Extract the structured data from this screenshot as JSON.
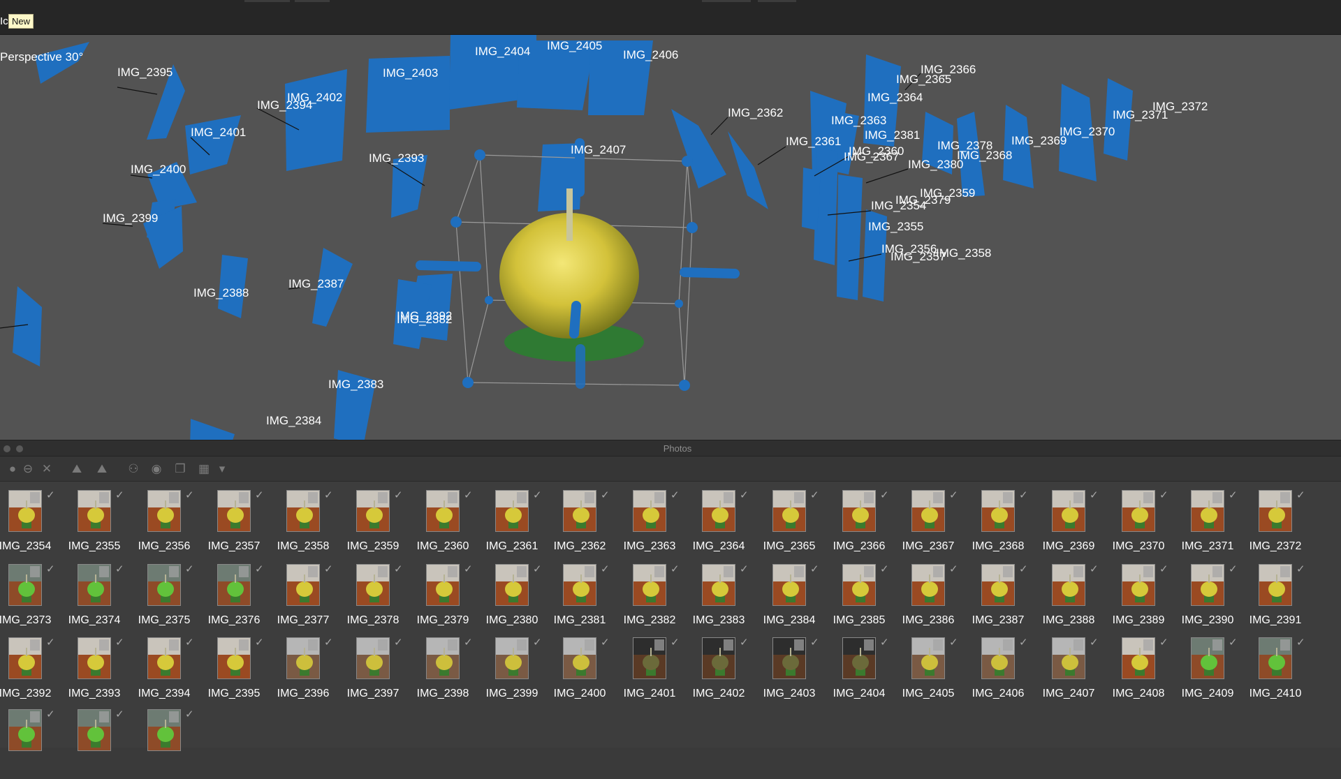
{
  "window": {
    "tooltip": "New",
    "tooltip_prefix": "Ic"
  },
  "viewport": {
    "view_label": "Perspective 30°",
    "camera_labels": [
      "IMG_2395",
      "IMG_2394",
      "IMG_2402",
      "IMG_2403",
      "IMG_2404",
      "IMG_2405",
      "IMG_2406",
      "IMG_2401",
      "IMG_2400",
      "IMG_2399",
      "IMG_2393",
      "IMG_2407",
      "IMG_2388",
      "IMG_2387",
      "IMG_2392",
      "IMG_2382",
      "IMG_2383",
      "IMG_2384",
      "IMG_2362",
      "IMG_2366",
      "IMG_2365",
      "IMG_2364",
      "IMG_2363",
      "IMG_2381",
      "IMG_2361",
      "IMG_2360",
      "IMG_2367",
      "IMG_2380",
      "IMG_2378",
      "IMG_2368",
      "IMG_2369",
      "IMG_2370",
      "IMG_2371",
      "IMG_2372",
      "IMG_2359",
      "IMG_2379",
      "IMG_2354",
      "IMG_2355",
      "IMG_2356",
      "IMG_2357",
      "IMG_2358"
    ]
  },
  "photos_panel": {
    "title": "Photos",
    "toolbar": [
      {
        "name": "add-icon",
        "glyph": "●"
      },
      {
        "name": "remove-icon",
        "glyph": "⊖"
      },
      {
        "name": "delete-icon",
        "glyph": "✕"
      },
      {
        "name": "enable-icon",
        "glyph": "⛰"
      },
      {
        "name": "disable-icon",
        "glyph": "⛰"
      },
      {
        "name": "binoculars-icon",
        "glyph": "⚇"
      },
      {
        "name": "mask-icon",
        "glyph": "◉"
      },
      {
        "name": "stack-icon",
        "glyph": "❐"
      },
      {
        "name": "view-mode-icon",
        "glyph": "▦"
      },
      {
        "name": "dropdown-icon",
        "glyph": "▾"
      }
    ],
    "photos": [
      "IMG_2354",
      "IMG_2355",
      "IMG_2356",
      "IMG_2357",
      "IMG_2358",
      "IMG_2359",
      "IMG_2360",
      "IMG_2361",
      "IMG_2362",
      "IMG_2363",
      "IMG_2364",
      "IMG_2365",
      "IMG_2366",
      "IMG_2367",
      "IMG_2368",
      "IMG_2369",
      "IMG_2370",
      "IMG_2371",
      "IMG_2372",
      "IMG_2373",
      "IMG_2374",
      "IMG_2375",
      "IMG_2376",
      "IMG_2377",
      "IMG_2378",
      "IMG_2379",
      "IMG_2380",
      "IMG_2381",
      "IMG_2382",
      "IMG_2383",
      "IMG_2384",
      "IMG_2385",
      "IMG_2386",
      "IMG_2387",
      "IMG_2388",
      "IMG_2389",
      "IMG_2390",
      "IMG_2391",
      "IMG_2392",
      "IMG_2393",
      "IMG_2394",
      "IMG_2395",
      "IMG_2396",
      "IMG_2397",
      "IMG_2398",
      "IMG_2399",
      "IMG_2400",
      "IMG_2401",
      "IMG_2402",
      "IMG_2403",
      "IMG_2404",
      "IMG_2405",
      "IMG_2406",
      "IMG_2407",
      "IMG_2408",
      "IMG_2409",
      "IMG_2410",
      "",
      "",
      ""
    ],
    "check_glyph": "✓"
  },
  "colors": {
    "camera_plane": "#1f6fbf",
    "viewport_bg": "#535353",
    "panel_bg": "#3d3d3d",
    "gourd": "#d9c83a"
  }
}
